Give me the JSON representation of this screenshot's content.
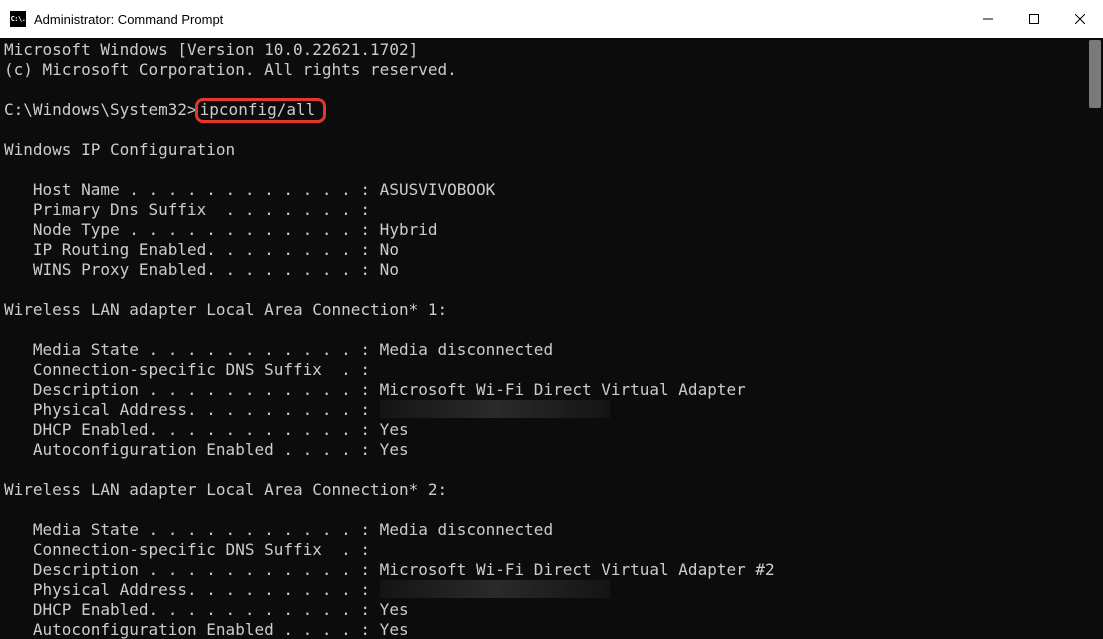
{
  "window": {
    "title": "Administrator: Command Prompt",
    "app_icon_text": "C:\\."
  },
  "prompt": {
    "path": "C:\\Windows\\System32>",
    "command": "ipconfig/all"
  },
  "header": {
    "line1": "Microsoft Windows [Version 10.0.22621.1702]",
    "line2": "(c) Microsoft Corporation. All rights reserved."
  },
  "ipcfg": {
    "title": "Windows IP Configuration",
    "rows": [
      {
        "label": "   Host Name . . . . . . . . . . . . : ",
        "value": "ASUSVIVOBOOK"
      },
      {
        "label": "   Primary Dns Suffix  . . . . . . . :",
        "value": ""
      },
      {
        "label": "   Node Type . . . . . . . . . . . . : ",
        "value": "Hybrid"
      },
      {
        "label": "   IP Routing Enabled. . . . . . . . : ",
        "value": "No"
      },
      {
        "label": "   WINS Proxy Enabled. . . . . . . . : ",
        "value": "No"
      }
    ]
  },
  "adapter1": {
    "title": "Wireless LAN adapter Local Area Connection* 1:",
    "rows": [
      {
        "label": "   Media State . . . . . . . . . . . : ",
        "value": "Media disconnected"
      },
      {
        "label": "   Connection-specific DNS Suffix  . :",
        "value": ""
      },
      {
        "label": "   Description . . . . . . . . . . . : ",
        "value": "Microsoft Wi-Fi Direct Virtual Adapter"
      },
      {
        "label": "   Physical Address. . . . . . . . . : ",
        "value": "",
        "redacted": true
      },
      {
        "label": "   DHCP Enabled. . . . . . . . . . . : ",
        "value": "Yes"
      },
      {
        "label": "   Autoconfiguration Enabled . . . . : ",
        "value": "Yes"
      }
    ]
  },
  "adapter2": {
    "title": "Wireless LAN adapter Local Area Connection* 2:",
    "rows": [
      {
        "label": "   Media State . . . . . . . . . . . : ",
        "value": "Media disconnected"
      },
      {
        "label": "   Connection-specific DNS Suffix  . :",
        "value": ""
      },
      {
        "label": "   Description . . . . . . . . . . . : ",
        "value": "Microsoft Wi-Fi Direct Virtual Adapter #2"
      },
      {
        "label": "   Physical Address. . . . . . . . . : ",
        "value": "",
        "redacted": true
      },
      {
        "label": "   DHCP Enabled. . . . . . . . . . . : ",
        "value": "Yes"
      },
      {
        "label": "   Autoconfiguration Enabled . . . . : ",
        "value": "Yes"
      }
    ]
  }
}
